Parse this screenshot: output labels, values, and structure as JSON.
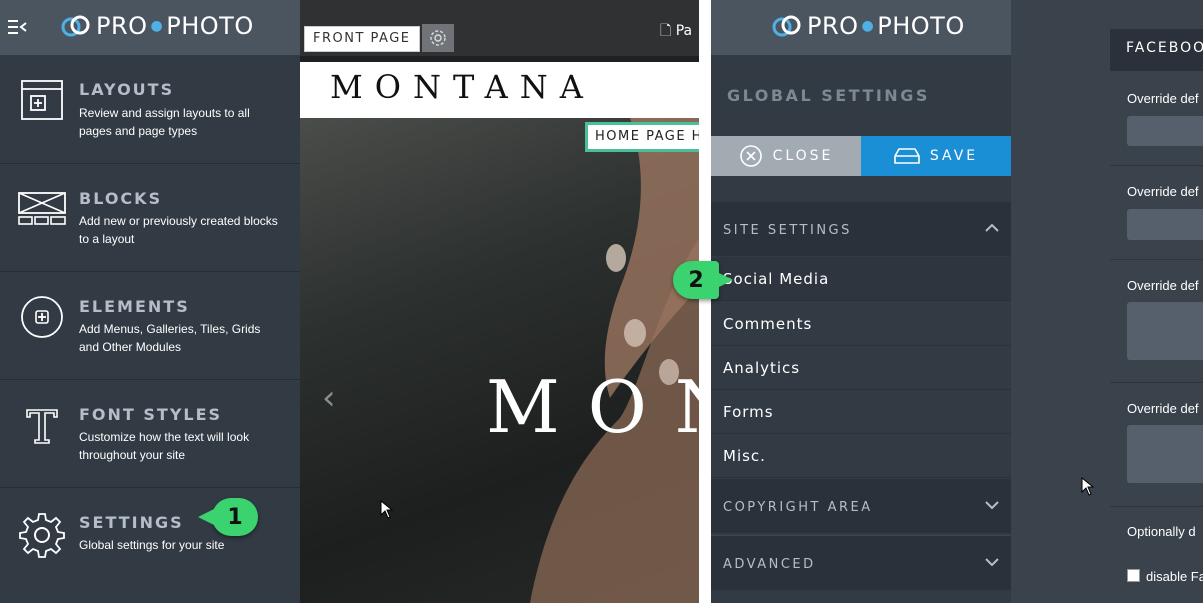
{
  "app": {
    "brand_left": "PRO",
    "brand_right": "PHOTO"
  },
  "left_menu": {
    "items": [
      {
        "title": "LAYOUTS",
        "desc": "Review and assign layouts to all pages and page types",
        "icon": "layout-icon"
      },
      {
        "title": "BLOCKS",
        "desc": "Add new or previously created blocks to a layout",
        "icon": "blocks-icon"
      },
      {
        "title": "ELEMENTS",
        "desc": "Add Menus, Galleries, Tiles, Grids and Other Modules",
        "icon": "plus-circle-icon"
      },
      {
        "title": "FONT STYLES",
        "desc": "Customize how the text will look throughout your site",
        "icon": "font-icon"
      },
      {
        "title": "SETTINGS",
        "desc": "Global settings for your site",
        "icon": "gear-icon"
      }
    ]
  },
  "preview": {
    "front_page_label": "FRONT PAGE",
    "page_link": "Pa",
    "site_logo": "MONTANA",
    "home_tag": "HOME PAGE H",
    "hero_text": "MON"
  },
  "settings": {
    "title": "GLOBAL SETTINGS",
    "close_label": "CLOSE",
    "save_label": "SAVE",
    "site_settings_label": "SITE SETTINGS",
    "sub_items": [
      "Social Media",
      "Comments",
      "Analytics",
      "Forms",
      "Misc."
    ],
    "copyright_label": "COPYRIGHT AREA",
    "advanced_label": "ADVANCED"
  },
  "facebook": {
    "header": "FACEBOO",
    "override_labels": [
      "Override def",
      "Override def",
      "Override def",
      "Override def"
    ],
    "optional_label": "Optionally d",
    "checkbox_label": "disable Fa"
  },
  "callouts": {
    "one": "1",
    "two": "2"
  },
  "colors": {
    "panel": "#323a44",
    "header": "#4b5560",
    "save": "#1b8fd6",
    "callout": "#3ad36f",
    "accent_tag": "#49c09a"
  }
}
